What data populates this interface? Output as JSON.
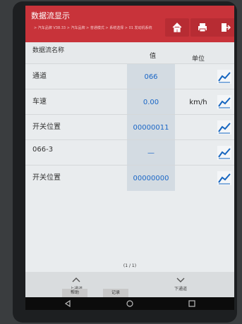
{
  "app": {
    "title": "数据流显示",
    "breadcrumb": "> 汽车品牌 V38.33 > 汽车品牌 > 普通模式 > 系统选择 > 01 发动机系统"
  },
  "columns": {
    "name": "数据流名称",
    "value": "值",
    "unit": "单位"
  },
  "rows": [
    {
      "name": "通道",
      "value": "066",
      "unit": ""
    },
    {
      "name": "车速",
      "value": "0.00",
      "unit": "km/h"
    },
    {
      "name": "开关位置",
      "value": "00000011",
      "unit": ""
    },
    {
      "name": "066-3",
      "value": "—",
      "unit": ""
    },
    {
      "name": "开关位置",
      "value": "00000000",
      "unit": ""
    }
  ],
  "pager": "(1 / 1)",
  "nav": {
    "up_label": "上通道",
    "down_label": "下通道"
  },
  "buttons": {
    "help": "帮助",
    "record": "记录"
  },
  "icons": {
    "home": "home-icon",
    "print": "print-icon",
    "exit": "exit-icon",
    "graph": "line-chart-icon",
    "nav_back": "back-triangle-icon",
    "nav_home": "home-circle-icon",
    "nav_recents": "recents-square-icon"
  },
  "colors": {
    "titlebar": "#c8333a",
    "value_text": "#1a66c6",
    "graph_icon": "#1565c0"
  }
}
